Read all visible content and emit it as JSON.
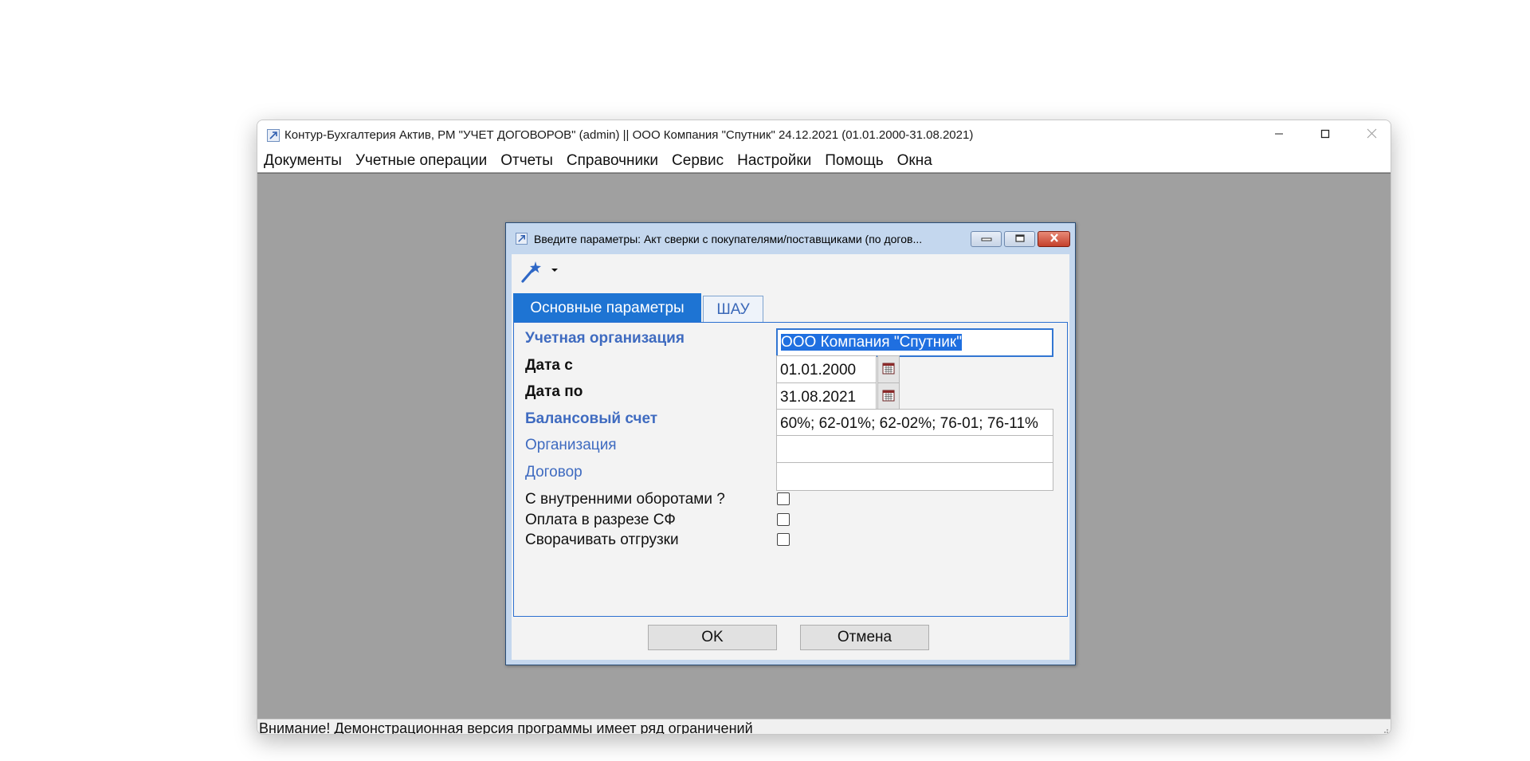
{
  "window": {
    "title": "Контур-Бухгалтерия Актив, РМ \"УЧЕТ ДОГОВОРОВ\" (admin) || ООО Компания \"Спутник\" 24.12.2021 (01.01.2000-31.08.2021)",
    "controls": {
      "minimize": "minimize-icon",
      "maximize": "maximize-icon",
      "close": "close-icon"
    }
  },
  "menu": {
    "items": [
      "Документы",
      "Учетные операции",
      "Отчеты",
      "Справочники",
      "Сервис",
      "Настройки",
      "Помощь",
      "Окна"
    ]
  },
  "statusbar": {
    "text": "Внимание! Демонстрационная версия программы имеет ряд ограничений"
  },
  "dialog": {
    "title": "Введите параметры: Акт сверки с покупателями/поставщиками (по догов...",
    "toolbar": {
      "wand_icon": "magic-wand-icon",
      "dropdown_icon": "chevron-down-icon"
    },
    "tabs": [
      {
        "label": "Основные параметры",
        "active": true
      },
      {
        "label": "ШАУ",
        "active": false
      }
    ],
    "fields": {
      "org": {
        "label": "Учетная организация",
        "value": "ООО Компания \"Спутник\""
      },
      "date_from": {
        "label": "Дата с",
        "value": "01.01.2000"
      },
      "date_to": {
        "label": "Дата по",
        "value": "31.08.2021"
      },
      "account": {
        "label": "Балансовый счет",
        "value": "60%; 62-01%; 62-02%; 76-01; 76-11%"
      },
      "organization": {
        "label": "Организация",
        "value": ""
      },
      "contract": {
        "label": "Договор",
        "value": ""
      }
    },
    "checkboxes": [
      {
        "label": "С внутренними оборотами ?",
        "checked": false
      },
      {
        "label": "Оплата в разрезе СФ",
        "checked": false
      },
      {
        "label": "Сворачивать отгрузки",
        "checked": false
      }
    ],
    "buttons": {
      "ok": "OK",
      "cancel": "Отмена"
    }
  },
  "colors": {
    "mdi_background": "#a0a0a0",
    "active_tab": "#1e74d3",
    "required_label": "#3f6bc0",
    "dialog_frame": "#c4d7ee"
  }
}
